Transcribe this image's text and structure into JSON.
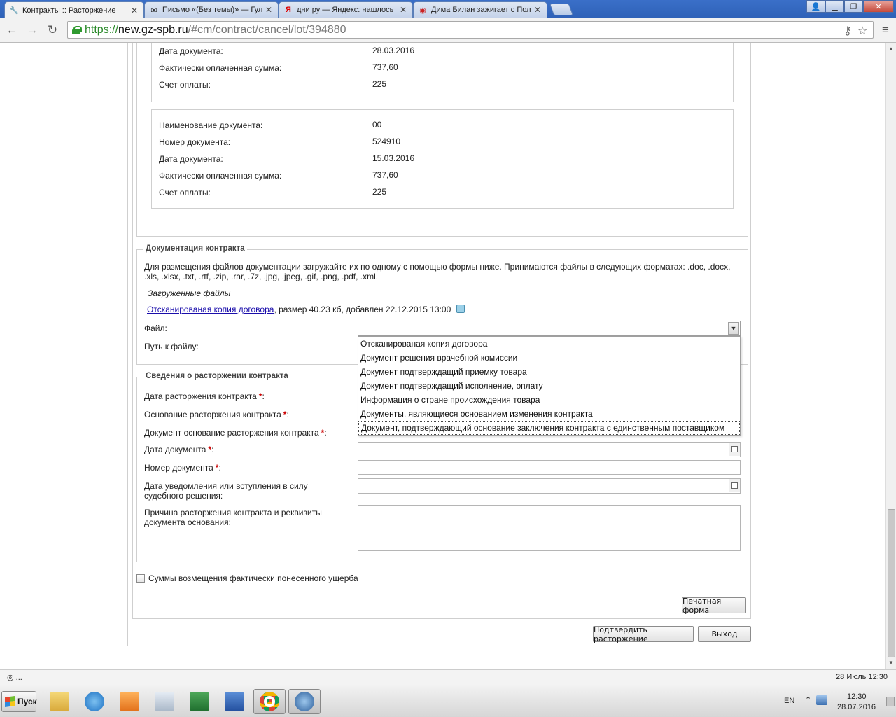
{
  "browser": {
    "tabs": [
      {
        "title": "Контракты :: Расторжение",
        "icon": "wrench-icon",
        "active": true
      },
      {
        "title": "Письмо «(Без темы)» — Гул",
        "icon": "mail-icon",
        "active": false
      },
      {
        "title": "дни ру — Яндекс: нашлось",
        "icon": "yandex-icon",
        "active": false
      },
      {
        "title": "Дима Билан зажигает с Пол",
        "icon": "target-icon",
        "active": false
      }
    ],
    "url_scheme": "https://",
    "url_host": "new.gz-spb.ru",
    "url_path": "/#cm/contract/cancel/lot/394880"
  },
  "payment_doc_prev": {
    "date_label": "Дата документа:",
    "date_value": "28.03.2016",
    "sum_label": "Фактически оплаченная сумма:",
    "sum_value": "737,60",
    "account_label": "Счет оплаты:",
    "account_value": "225"
  },
  "payment_doc": {
    "name_label": "Наименование документа:",
    "name_value": "00",
    "number_label": "Номер документа:",
    "number_value": "524910",
    "date_label": "Дата документа:",
    "date_value": "15.03.2016",
    "sum_label": "Фактически оплаченная сумма:",
    "sum_value": "737,60",
    "account_label": "Счет оплаты:",
    "account_value": "225"
  },
  "documentation": {
    "legend": "Документация контракта",
    "info": "Для размещения файлов документации загружайте их по одному с помощью формы ниже. Принимаются файлы в следующих форматах: .doc, .docx, .xls, .xlsx, .txt, .rtf, .zip, .rar, .7z, .jpg, .jpeg, .gif, .png, .pdf, .xml.",
    "uploaded_heading": "Загруженные файлы",
    "file_link": "Отсканированая копия договора",
    "file_meta": ", размер 40.23 кб, добавлен 22.12.2015 13:00",
    "file_label": "Файл:",
    "path_label": "Путь к файлу:",
    "select_value": "",
    "options": [
      "Отсканированая копия договора",
      "Документ решения врачебной комиссии",
      "Документ подтверждащий приемку товара",
      "Документ подтверждащий исполнение, оплату",
      "Информация о стране происхождения товара",
      "Документы, являющиеся основанием изменения контракта",
      "Документ, подтверждающий основание заключения контракта с единственным поставщиком"
    ]
  },
  "termination": {
    "legend": "Сведения о расторжении контракта",
    "date_label": "Дата расторжения контракта",
    "basis_label": "Основание расторжения контракта",
    "basis_doc_label": "Документ основание расторжения контракта",
    "doc_date_label": "Дата документа",
    "doc_number_label": "Номер документа",
    "notice_date_label_1": "Дата уведомления или вступления в силу",
    "notice_date_label_2": "судебного решения:",
    "reason_label_1": "Причина расторжения контракта и реквизиты",
    "reason_label_2": "документа основания:",
    "required_mark": "*",
    "colon": ":"
  },
  "damages_checkbox_label": "Суммы возмещения фактически понесенного ущерба",
  "buttons": {
    "print": "Печатная форма",
    "confirm": "Подтвердить расторжение",
    "exit": "Выход"
  },
  "statusbar": {
    "left": "◎ ...",
    "right": "28 Июль 12:30"
  },
  "taskbar": {
    "start": "Пуск",
    "lang": "EN",
    "time": "12:30",
    "date": "28.07.2016"
  }
}
